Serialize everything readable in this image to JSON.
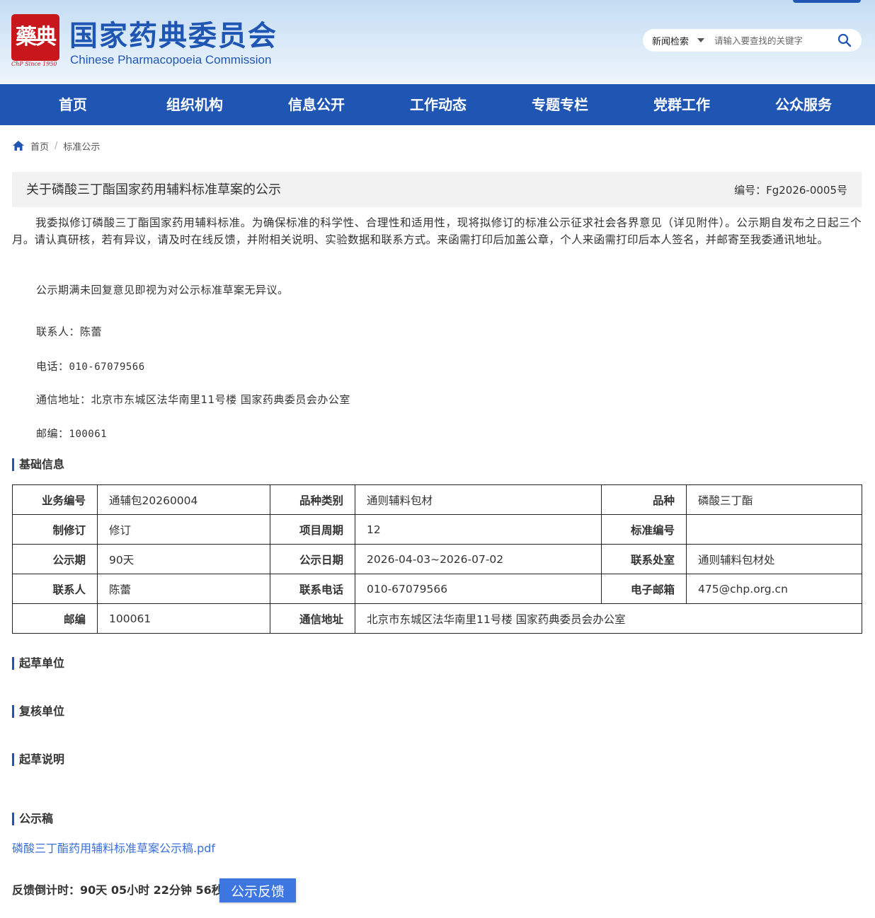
{
  "header": {
    "logo_seal_text": "藥典",
    "logo_since": "ChP Since 1950",
    "title_cn": "国家药典委员会",
    "title_en": "Chinese Pharmacopoeia Commission",
    "search": {
      "category": "新闻检索",
      "placeholder": "请输入要查找的关键字",
      "icon": "search-icon"
    }
  },
  "nav": {
    "items": [
      "首页",
      "组织机构",
      "信息公开",
      "工作动态",
      "专题专栏",
      "党群工作",
      "公众服务"
    ]
  },
  "breadcrumb": {
    "home": "首页",
    "current": "标准公示"
  },
  "article": {
    "title": "关于磷酸三丁酯国家药用辅料标准草案的公示",
    "code": "编号：Fg2026-0005号",
    "intro": "我委拟修订磷酸三丁酯国家药用辅料标准。为确保标准的科学性、合理性和适用性，现将拟修订的标准公示征求社会各界意见（详见附件）。公示期自发布之日起三个月。请认真研核，若有异议，请及时在线反馈，并附相关说明、实验数据和联系方式。来函需打印后加盖公章，个人来函需打印后本人签名，并邮寄至我委通讯地址。",
    "note": "公示期满未回复意见即视为对公示标准草案无异议。",
    "contact_label": "联系人：",
    "contact": "陈蕾",
    "phone_label": "电话：",
    "phone": "010-67079566",
    "address": "通信地址：北京市东城区法华南里11号楼 国家药典委员会办公室",
    "postcode_label": "邮编：",
    "postcode": "100061"
  },
  "sections": {
    "basic_info": "基础信息",
    "drafting_unit": "起草单位",
    "review_unit": "复核单位",
    "drafting_notes": "起草说明",
    "draft_doc": "公示稿"
  },
  "info_table": {
    "rows": [
      [
        {
          "label": "业务编号",
          "value": "通辅包20260004"
        },
        {
          "label": "品种类别",
          "value": "通则辅料包材"
        },
        {
          "label": "品种",
          "value": "磷酸三丁酯"
        }
      ],
      [
        {
          "label": "制修订",
          "value": "修订"
        },
        {
          "label": "项目周期",
          "value": "12"
        },
        {
          "label": "标准编号",
          "value": ""
        }
      ],
      [
        {
          "label": "公示期",
          "value": "90天"
        },
        {
          "label": "公示日期",
          "value": "2026-04-03~2026-07-02"
        },
        {
          "label": "联系处室",
          "value": "通则辅料包材处"
        }
      ],
      [
        {
          "label": "联系人",
          "value": "陈蕾"
        },
        {
          "label": "联系电话",
          "value": "010-67079566"
        },
        {
          "label": "电子邮箱",
          "value": "475@chp.org.cn"
        }
      ],
      [
        {
          "label": "邮编",
          "value": "100061"
        },
        {
          "label": "通信地址",
          "value": "北京市东城区法华南里11号楼 国家药典委员会办公室"
        }
      ]
    ]
  },
  "attachment": {
    "filename": "磷酸三丁酯药用辅料标准草案公示稿.pdf"
  },
  "countdown": {
    "text": "反馈倒计时：90天 05小时 22分钟 56秒",
    "button": "公示反馈"
  },
  "colors": {
    "brand_blue": "#1f56b4",
    "seal_red": "#c8161d",
    "link_blue": "#3b6fd6",
    "button_blue": "#3d76e0"
  }
}
